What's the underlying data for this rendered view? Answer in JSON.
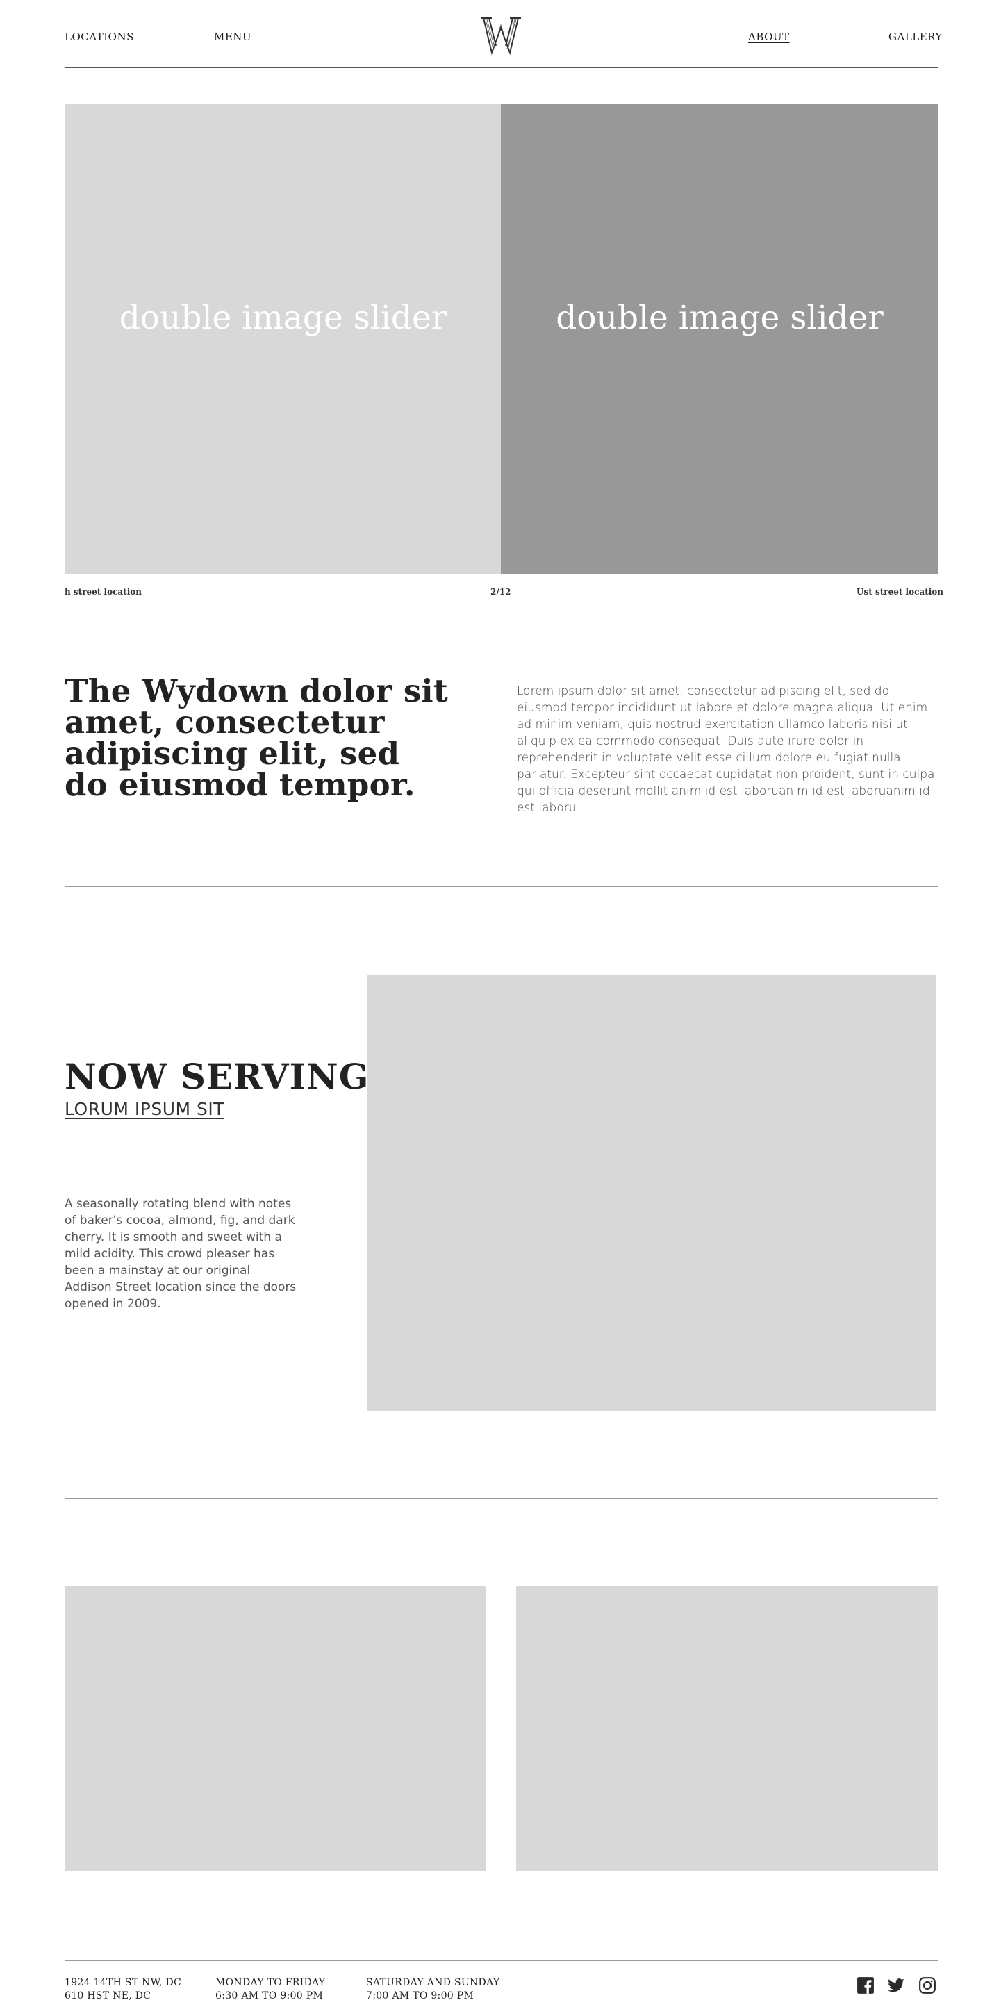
{
  "header": {
    "nav_left": [
      "LOCATIONS",
      "MENU"
    ],
    "nav_right": [
      "ABOUT",
      "GALLERY"
    ],
    "logo_letter": "W",
    "icons": {
      "logo": "wydown-w-logo"
    }
  },
  "slider": {
    "slides": [
      "double image slider",
      "double image slider"
    ],
    "caption_left": "h street location",
    "counter": "2/12",
    "caption_right": "Ust street location"
  },
  "intro": {
    "heading": "The Wydown dolor sit amet, consectetur adipiscing elit, sed do eiusmod tempor.",
    "body": "Lorem ipsum dolor sit amet, consectetur adipiscing elit, sed do eiusmod tempor incididunt ut labore et dolore magna aliqua. Ut enim ad minim veniam, quis nostrud exercitation ullamco laboris nisi ut aliquip ex ea commodo consequat. Duis aute irure dolor in reprehenderit in voluptate velit esse cillum dolore eu fugiat nulla pariatur. Excepteur sint occaecat cupidatat non proident, sunt in culpa qui officia deserunt mollit anim id est laboruanim id est laboruanim id est laboru"
  },
  "now_serving": {
    "title": "NOW SERVING",
    "subtitle": "LORUM IPSUM SIT",
    "body": "A seasonally rotating blend with notes of baker's cocoa, almond, fig, and dark cherry. It is smooth and sweet with a mild acidity. This crowd pleaser has been a mainstay at our original Addison Street location since the doors opened in 2009."
  },
  "footer": {
    "addresses": [
      "1924 14TH ST NW, DC",
      "610 HST NE, DC"
    ],
    "weekday": [
      "MONDAY TO FRIDAY",
      "6:30 AM TO 9:00 PM"
    ],
    "weekend": [
      "SATURDAY AND SUNDAY",
      "7:00 AM TO 9:00 PM"
    ],
    "icons": [
      "facebook-icon",
      "twitter-icon",
      "instagram-icon"
    ]
  },
  "colors": {
    "text": "#222222",
    "placeholder_light": "#d8d8d8",
    "placeholder_dark": "#989898",
    "rule": "#9a9a9a"
  }
}
